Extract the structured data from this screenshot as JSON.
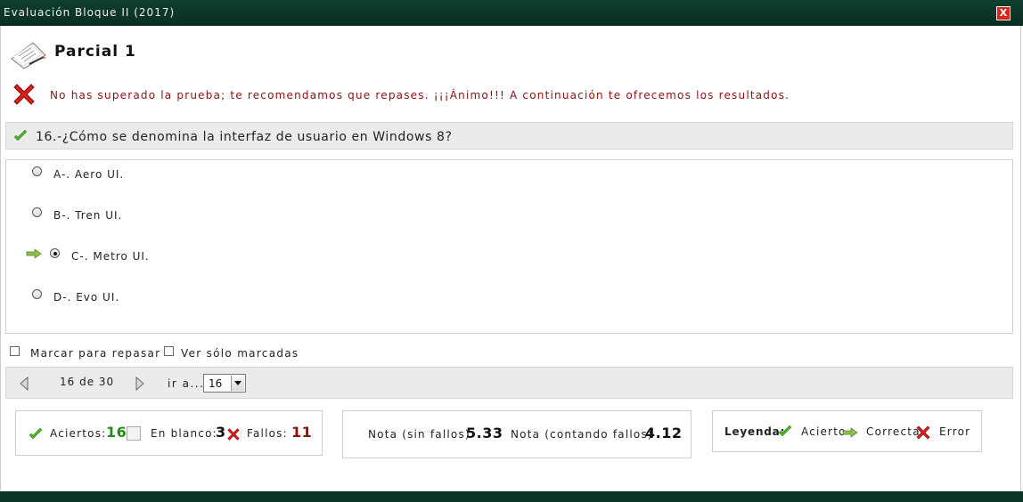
{
  "window": {
    "title": "Evaluación Bloque II (2017)",
    "close_label": "X"
  },
  "header": {
    "title": "Parcial 1"
  },
  "result": {
    "message": "No has superado la prueba; te recomendamos que repases. ¡¡¡Ánimo!!! A continuación te ofrecemos los resultados."
  },
  "question": {
    "text": "16.-¿Cómo se denomina la interfaz de usuario en Windows 8?",
    "status": "correct"
  },
  "answers": [
    {
      "label": "A-. Aero UI.",
      "selected": false
    },
    {
      "label": "B-. Tren UI.",
      "selected": false
    },
    {
      "label": "C-. Metro UI.",
      "selected": true,
      "correct": true
    },
    {
      "label": "D-. Evo UI.",
      "selected": false
    }
  ],
  "marking": {
    "mark_label": "Marcar para repasar",
    "show_marked_label": "Ver sólo marcadas"
  },
  "navigation": {
    "count": "16 de 30",
    "goto_label": "ir a...",
    "goto_value": "16"
  },
  "stats": {
    "aciertos_label": "Aciertos:",
    "aciertos": "16",
    "blanco_label": "En blanco:",
    "blanco": "3",
    "fallos_label": "Fallos:",
    "fallos": "11"
  },
  "notes": {
    "sin_fallos_label": "Nota (sin fallos)",
    "sin_fallos": "5.33",
    "contando_label": "Nota (contando fallos)",
    "contando": "4.12"
  },
  "legend": {
    "title": "Leyenda:",
    "acierto": "Acierto",
    "correcta": "Correcta",
    "error": "Error"
  },
  "colors": {
    "titlebar": "#0e3f31",
    "error_text": "#8b1010",
    "success": "#2a8a1a"
  },
  "icons": [
    "exam-icon",
    "error-x-icon",
    "checkmark-icon",
    "arrow-right-icon",
    "prev-arrow-icon",
    "next-arrow-icon"
  ]
}
